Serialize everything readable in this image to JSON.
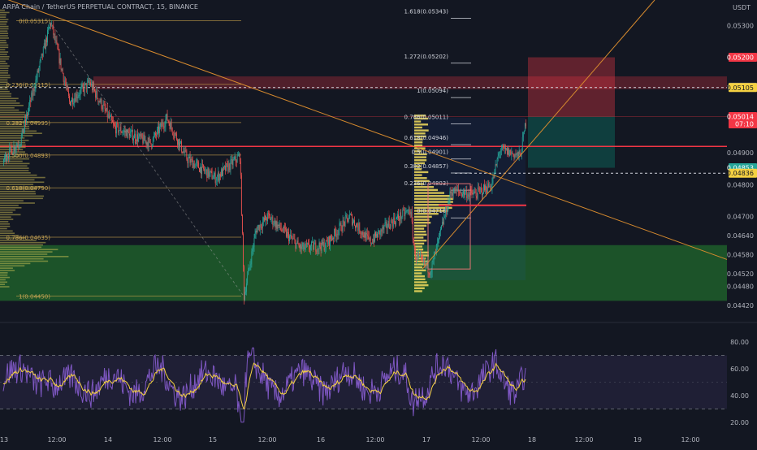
{
  "header": {
    "title": "ARPA Chain / TetherUS PERPETUAL CONTRACT, 15, BINANCE",
    "currency": "USDT"
  },
  "colors": {
    "background": "#131722",
    "up": "#26a69a",
    "down": "#ef5350",
    "fib_line": "#c8a24a",
    "trendline": "#d68a2e",
    "rsi_line": "#7e57c2",
    "rsi_ma": "#f5d142",
    "volume_profile": "#e5d35a",
    "demand_zone": "#1b5e20",
    "supply_zone": "#f23645"
  },
  "chart_data": {
    "type": "candlestick",
    "price_axis": {
      "ticks": [
        "0.05300",
        "0.04900",
        "0.04800",
        "0.04700",
        "0.04640",
        "0.04580",
        "0.04520",
        "0.04480",
        "0.04420"
      ],
      "ylim": [
        0.0439,
        0.0538
      ]
    },
    "price_labels": [
      {
        "text": "0.05200",
        "value": 0.052,
        "color": "#f23645",
        "fg": "#ffffff"
      },
      {
        "text": "0.05106",
        "value": 0.05106,
        "color": "#787b86",
        "fg": "#ffffff"
      },
      {
        "text": "0.05105",
        "value": 0.05105,
        "color": "#f5d142",
        "fg": "#131722"
      },
      {
        "text": "0.05014",
        "value": 0.05014,
        "color": "#f23645",
        "fg": "#ffffff",
        "sub": "07:10"
      },
      {
        "text": "0.04853",
        "value": 0.04853,
        "color": "#26a69a",
        "fg": "#ffffff"
      },
      {
        "text": "0.04836",
        "value": 0.04836,
        "color": "#f5d142",
        "fg": "#131722"
      }
    ],
    "time_axis": {
      "ticks": [
        "13",
        "12:00",
        "14",
        "12:00",
        "15",
        "12:00",
        "16",
        "12:00",
        "17",
        "12:00",
        "18",
        "12:00",
        "19",
        "12:00"
      ]
    },
    "fib_left": {
      "levels": [
        "0(0.05315)",
        "0.236(0.05115)",
        "0.382(0.04995)",
        "0.500(0.04893)",
        "0.618(0.04790)",
        "0.786(0.04635)",
        "1(0.04450)"
      ],
      "values": [
        0.05315,
        0.05115,
        0.04995,
        0.04893,
        0.0479,
        0.04635,
        0.0445
      ]
    },
    "fib_right": {
      "levels": [
        "1.618(0.05343)",
        "1.272(0.05202)",
        "1(0.05094)",
        "0.786(0.05011)",
        "0.618(0.04946)",
        "0.5(0.04901)",
        "0.382(0.04857)",
        "0.236(0.04803)",
        "0(0.04716)"
      ],
      "values": [
        0.05343,
        0.05202,
        0.05094,
        0.05011,
        0.04946,
        0.04901,
        0.04857,
        0.04803,
        0.04716
      ]
    },
    "zones": {
      "supply": [
        0.0514,
        0.051
      ],
      "demand": [
        0.0461,
        0.04435
      ],
      "horizontal_lines": [
        0.05105,
        0.0492,
        0.04836
      ]
    },
    "position": {
      "target": 0.052,
      "entry": 0.05014,
      "stop": 0.04853
    },
    "rsi": {
      "ticks": [
        "80.00",
        "60.00",
        "40.00",
        "20.00"
      ],
      "ylim": [
        15,
        88
      ],
      "band": [
        70,
        30
      ]
    }
  }
}
